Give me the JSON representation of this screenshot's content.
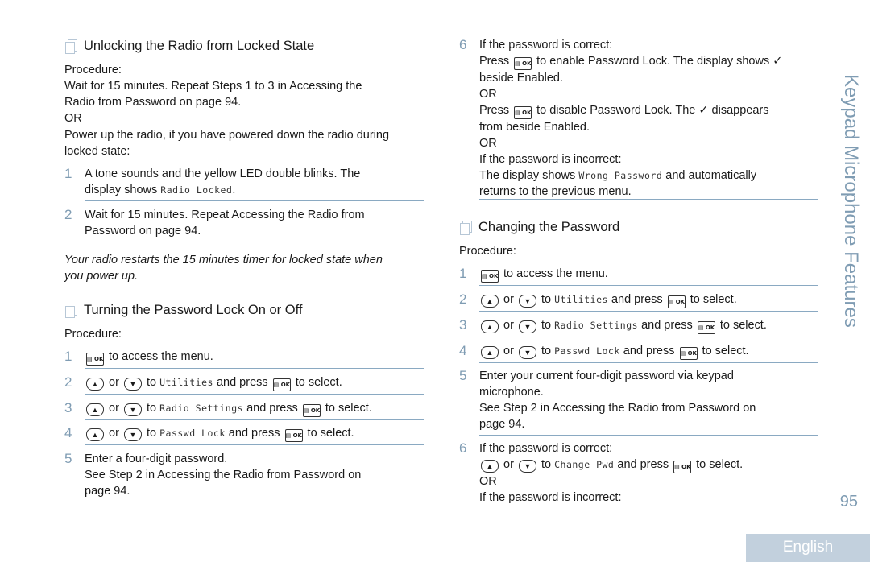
{
  "sidebar": {
    "section_title": "Keypad Microphone Features",
    "page_number": "95",
    "language_tab": "English"
  },
  "icons": {
    "ok_key": "menu-ok-key-icon",
    "up_key": "up-arrow-key-icon",
    "down_key": "down-arrow-key-icon",
    "section": "section-pages-icon",
    "check": "checkmark-icon"
  },
  "keys": {
    "ok": "▤ OK",
    "up": "▲",
    "down": "▼",
    "check": "✓"
  },
  "common": {
    "procedure": "Procedure:",
    "or": "OR",
    "or_word": " or ",
    "to": " to ",
    "and_press": " and press ",
    "to_select": " to select.",
    "to_access_menu": " to access the menu."
  },
  "unlocking": {
    "title": "Unlocking the Radio from Locked State",
    "line1": "Wait for 15 minutes. Repeat Steps 1 to 3 in Accessing the",
    "line2": "Radio from Password    on page 94.",
    "line3": "Power up the radio, if you have powered down the radio during",
    "line4": "locked state:",
    "steps": [
      {
        "num": "1",
        "text1": "A tone sounds and the yellow LED double blinks. The",
        "text2_pre": "display shows ",
        "display": "Radio Locked",
        "text2_post": "."
      },
      {
        "num": "2",
        "text1": "Wait for 15 minutes. Repeat Accessing the Radio from",
        "text2": "Password   on page 94."
      }
    ],
    "note1": "Your radio restarts the 15 minutes timer for locked state when",
    "note2": "you power up."
  },
  "turning": {
    "title": "Turning the Password Lock On or Off",
    "steps": [
      {
        "num": "1"
      },
      {
        "num": "2",
        "display": "Utilities"
      },
      {
        "num": "3",
        "display": "Radio Settings"
      },
      {
        "num": "4",
        "display": "Passwd Lock"
      },
      {
        "num": "5",
        "text1": "Enter a four-digit password.",
        "text2": "See Step 2 in Accessing the Radio from Password      on",
        "text3": "page 94."
      },
      {
        "num": "6",
        "l1": "If the password is correct:",
        "l2_pre": "Press ",
        "l2_post": " to enable Password Lock. The display shows ",
        "l3": "beside Enabled.",
        "l5_pre": "Press ",
        "l5_mid": " to disable Password Lock. The ",
        "l5_post": " disappears",
        "l6": "from beside Enabled.",
        "l8": "If the password is incorrect:",
        "l9_pre": "The display shows ",
        "l9_display": "Wrong Password",
        "l9_post": " and automatically",
        "l10": "returns to the previous menu."
      }
    ]
  },
  "changing": {
    "title": "Changing the Password",
    "steps": [
      {
        "num": "1"
      },
      {
        "num": "2",
        "display": "Utilities"
      },
      {
        "num": "3",
        "display": "Radio Settings"
      },
      {
        "num": "4",
        "display": "Passwd Lock"
      },
      {
        "num": "5",
        "text1": "Enter your current four-digit password via keypad",
        "text2": "microphone.",
        "text3": "See Step 2 in Accessing the Radio from Password      on",
        "text4": "page 94."
      },
      {
        "num": "6",
        "l1": "If the password is correct:",
        "display": "Change Pwd",
        "l4": "If the password is incorrect:"
      }
    ]
  }
}
